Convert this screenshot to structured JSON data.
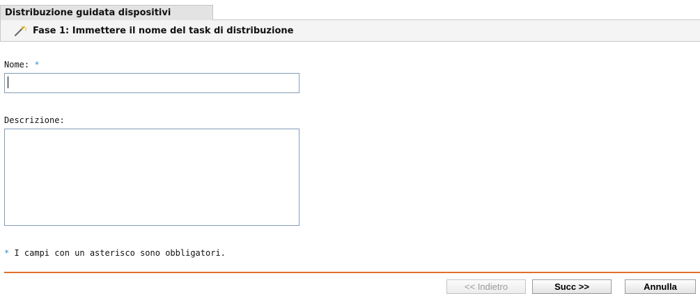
{
  "wizard": {
    "tab_title": "Distribuzione guidata dispositivi",
    "step_icon": "wand-icon",
    "step_title": "Fase 1: Immettere il nome del task di distribuzione"
  },
  "form": {
    "name_label": "Nome:",
    "name_required_mark": "*",
    "name_value": "",
    "description_label": "Descrizione:",
    "description_value": "",
    "required_note_mark": "*",
    "required_note": " I campi con un asterisco sono obbligatori."
  },
  "buttons": {
    "back_label": "<< Indietro",
    "back_enabled": false,
    "next_label": "Succ >>",
    "cancel_label": "Annulla"
  },
  "colors": {
    "accent_separator": "#e0702d",
    "required_mark": "#3a8fc8",
    "input_border": "#7f9db9"
  }
}
